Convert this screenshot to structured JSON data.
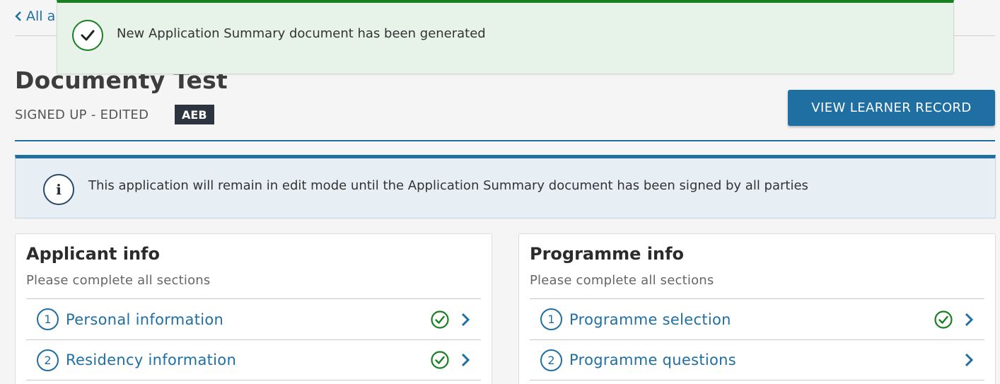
{
  "back_link": {
    "label": "All a"
  },
  "toast": {
    "message": "New Application Summary document has been generated"
  },
  "header": {
    "title": "Documenty Test",
    "status": "SIGNED UP - EDITED",
    "badge": "AEB",
    "view_button": "VIEW LEARNER RECORD"
  },
  "info_banner": {
    "text": "This application will remain in edit mode until the Application Summary document has been signed by all parties"
  },
  "cards": [
    {
      "title": "Applicant info",
      "subtitle": "Please complete all sections",
      "rows": [
        {
          "num": "1",
          "label": "Personal information",
          "complete": true
        },
        {
          "num": "2",
          "label": "Residency information",
          "complete": true
        }
      ]
    },
    {
      "title": "Programme info",
      "subtitle": "Please complete all sections",
      "rows": [
        {
          "num": "1",
          "label": "Programme selection",
          "complete": true
        },
        {
          "num": "2",
          "label": "Programme questions",
          "complete": false
        }
      ]
    }
  ],
  "colors": {
    "primary": "#1f6fa3",
    "success": "#1a7f21",
    "toast_bg": "#e7f2e8",
    "info_bg": "#e7eef4",
    "badge_bg": "#2c3440"
  }
}
